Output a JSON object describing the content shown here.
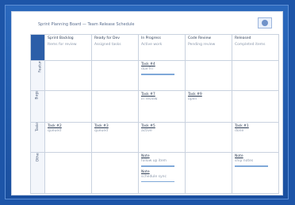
{
  "title": "Sprint Planning Board — Team Release Schedule",
  "columns": [
    {
      "name": "Sprint Backlog",
      "sub": "Items for review"
    },
    {
      "name": "Ready for Dev",
      "sub": "Assigned tasks"
    },
    {
      "name": "In Progress",
      "sub": "Active work"
    },
    {
      "name": "Code Review",
      "sub": "Pending review"
    },
    {
      "name": "Released",
      "sub": "Completed items"
    }
  ],
  "lanes": [
    {
      "name": "Features"
    },
    {
      "name": "Bugs"
    },
    {
      "name": "Tasks"
    },
    {
      "name": "Other"
    }
  ],
  "cells": [
    [
      [],
      [],
      [
        {
          "title": "Task #4",
          "meta": "due Fri",
          "line": true
        }
      ],
      [],
      []
    ],
    [
      [],
      [],
      [
        {
          "title": "Task #7",
          "meta": "in review",
          "line": false
        }
      ],
      [
        {
          "title": "Task #9",
          "meta": "open",
          "line": false
        }
      ],
      []
    ],
    [
      [
        {
          "title": "Task #2",
          "meta": "queued",
          "line": false
        }
      ],
      [
        {
          "title": "Task #3",
          "meta": "queued",
          "line": false
        }
      ],
      [
        {
          "title": "Task #5",
          "meta": "active",
          "line": false
        }
      ],
      [],
      [
        {
          "title": "Task #1",
          "meta": "done",
          "line": false
        }
      ]
    ],
    [
      [],
      [],
      [
        {
          "title": "Note",
          "meta": "follow up item",
          "line": true
        },
        {
          "title": "Note",
          "meta": "schedule sync",
          "line": true
        }
      ],
      [],
      [
        {
          "title": "Note",
          "meta": "ship notes",
          "line": true
        }
      ]
    ]
  ]
}
